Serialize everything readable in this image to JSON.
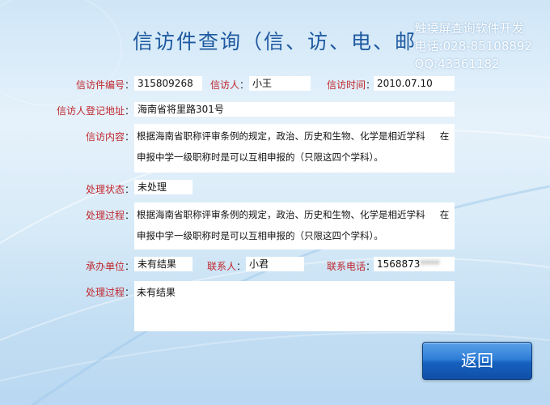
{
  "header": {
    "title": "信访件查询（信、访、电、邮",
    "vendor": {
      "line1": "触摸屏查询软件开发",
      "line2": "电话:028-85108892",
      "line3": "QQ:43361182"
    }
  },
  "form": {
    "case_number": {
      "label": "信访件编号",
      "value": "315809268"
    },
    "petitioner": {
      "label": "信访人",
      "value": "小王"
    },
    "petition_time": {
      "label": "信访时间",
      "value": "2010.07.10"
    },
    "address": {
      "label": "信访人登记地址",
      "value": "海南省将里路301号"
    },
    "content": {
      "label": "信访内容",
      "value": "根据海南省职称评审条例的规定，政治、历史和生物、化学是相近学科     在申报中学一级职称时是可以互相申报的（只限这四个学科）。"
    },
    "status": {
      "label": "处理状态",
      "value": "未处理"
    },
    "process1": {
      "label": "处理过程",
      "value": "根据海南省职称评审条例的规定，政治、历史和生物、化学是相近学科     在申报中学一级职称时是可以互相申报的（只限这四个学科）。"
    },
    "unit": {
      "label": "承办单位",
      "value": "未有结果"
    },
    "contact": {
      "label": "联系人",
      "value": "小君"
    },
    "phone": {
      "label": "联系电话",
      "value": "1568873"
    },
    "process2": {
      "label": "处理过程",
      "value": "未有结果"
    }
  },
  "actions": {
    "back_label": "返回"
  }
}
